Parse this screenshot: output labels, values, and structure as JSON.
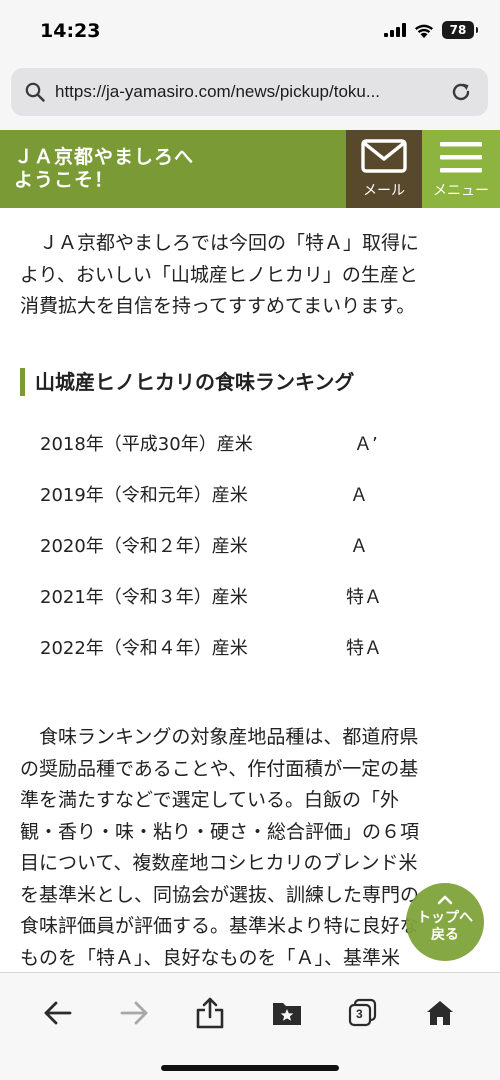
{
  "status": {
    "time": "14:23",
    "battery": "78"
  },
  "browser": {
    "url": "https://ja-yamasiro.com/news/pickup/toku..."
  },
  "header": {
    "title_line1": "ＪＡ京都やましろへ",
    "title_line2": "ようこそ！",
    "mail_label": "メール",
    "menu_label": "メニュー"
  },
  "article": {
    "intro_lines": [
      "ＪＡ京都やましろでは今回の「特Ａ」取得に",
      "より、おいしい「山城産ヒノヒカリ」の生産と",
      "消費拡大を自信を持ってすすめてまいります。"
    ],
    "ranking_heading": "山城産ヒノヒカリの食味ランキング",
    "rankings": [
      {
        "year": "2018年（平成30年）産米",
        "grade": "Ａ’"
      },
      {
        "year": "2019年（令和元年）産米",
        "grade": "Ａ"
      },
      {
        "year": "2020年（令和２年）産米",
        "grade": "Ａ"
      },
      {
        "year": "2021年（令和３年）産米",
        "grade": "特Ａ"
      },
      {
        "year": "2022年（令和４年）産米",
        "grade": "特Ａ"
      }
    ],
    "body_lines": [
      "食味ランキングの対象産地品種は、都道府県",
      "の奨励品種であることや、作付面積が一定の基",
      "準を満たすなどで選定している。白飯の「外",
      "観・香り・味・粘り・硬さ・総合評価」の６項",
      "目について、複数産地コシヒカリのブレンド米",
      "を基準米とし、同協会が選抜、訓練した専門の",
      "食味評価員が評価する。基準米より特に良好な",
      "ものを「特Ａ」、良好なものを「Ａ」、基準米"
    ]
  },
  "top_button": {
    "line1": "トップへ",
    "line2": "戻る"
  },
  "toolbar": {
    "tabs_count": "3"
  },
  "colors": {
    "header_green": "#7a9a36",
    "mail_brown": "#58492c",
    "menu_green": "#8cb43e"
  }
}
